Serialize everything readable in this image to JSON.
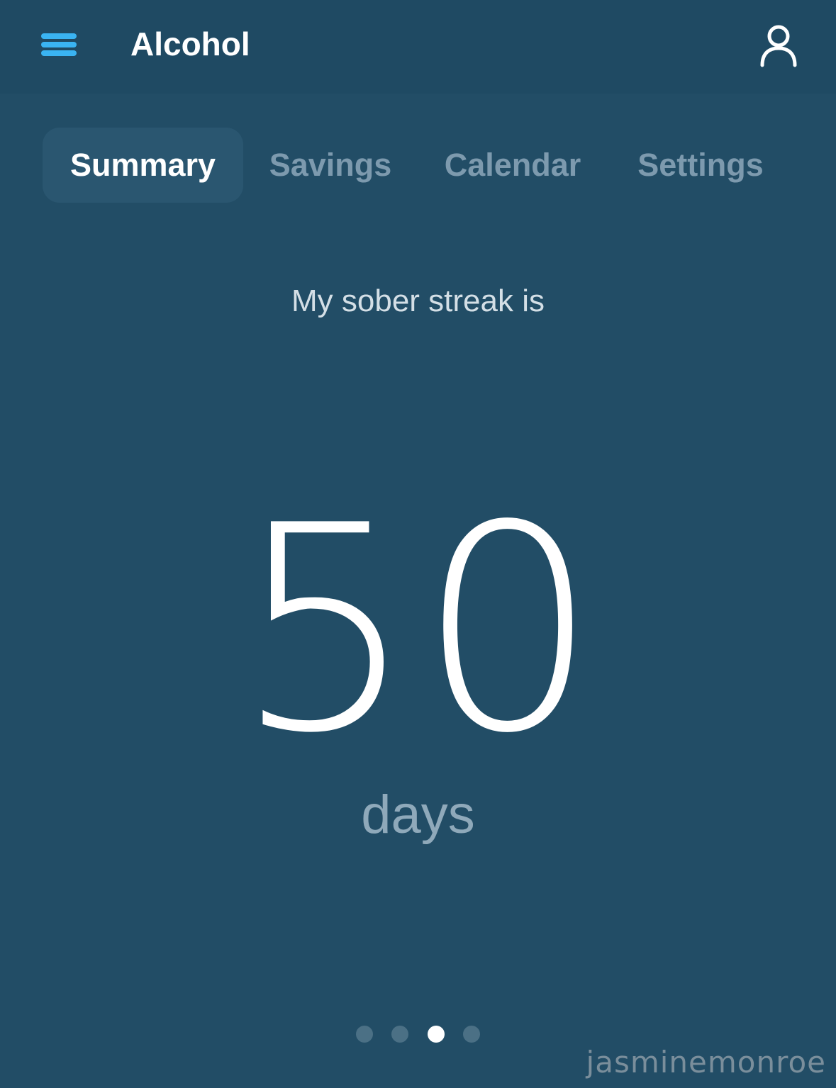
{
  "header": {
    "title": "Alcohol",
    "menu_icon": "hamburger-menu-icon",
    "profile_icon": "user-profile-icon",
    "accent_color": "#3ab4f2"
  },
  "tabs": [
    {
      "label": "Summary",
      "active": true
    },
    {
      "label": "Savings",
      "active": false
    },
    {
      "label": "Calendar",
      "active": false
    },
    {
      "label": "Settings",
      "active": false
    }
  ],
  "streak": {
    "label": "My sober streak is",
    "value": "50",
    "unit": "days"
  },
  "pager": {
    "count": 4,
    "active_index": 2
  },
  "watermark": "jasminemonroe",
  "colors": {
    "background": "#224d66",
    "header_background": "#1f4a63",
    "active_tab_background": "#2a5670",
    "inactive_tab_text": "#7d9aae"
  }
}
